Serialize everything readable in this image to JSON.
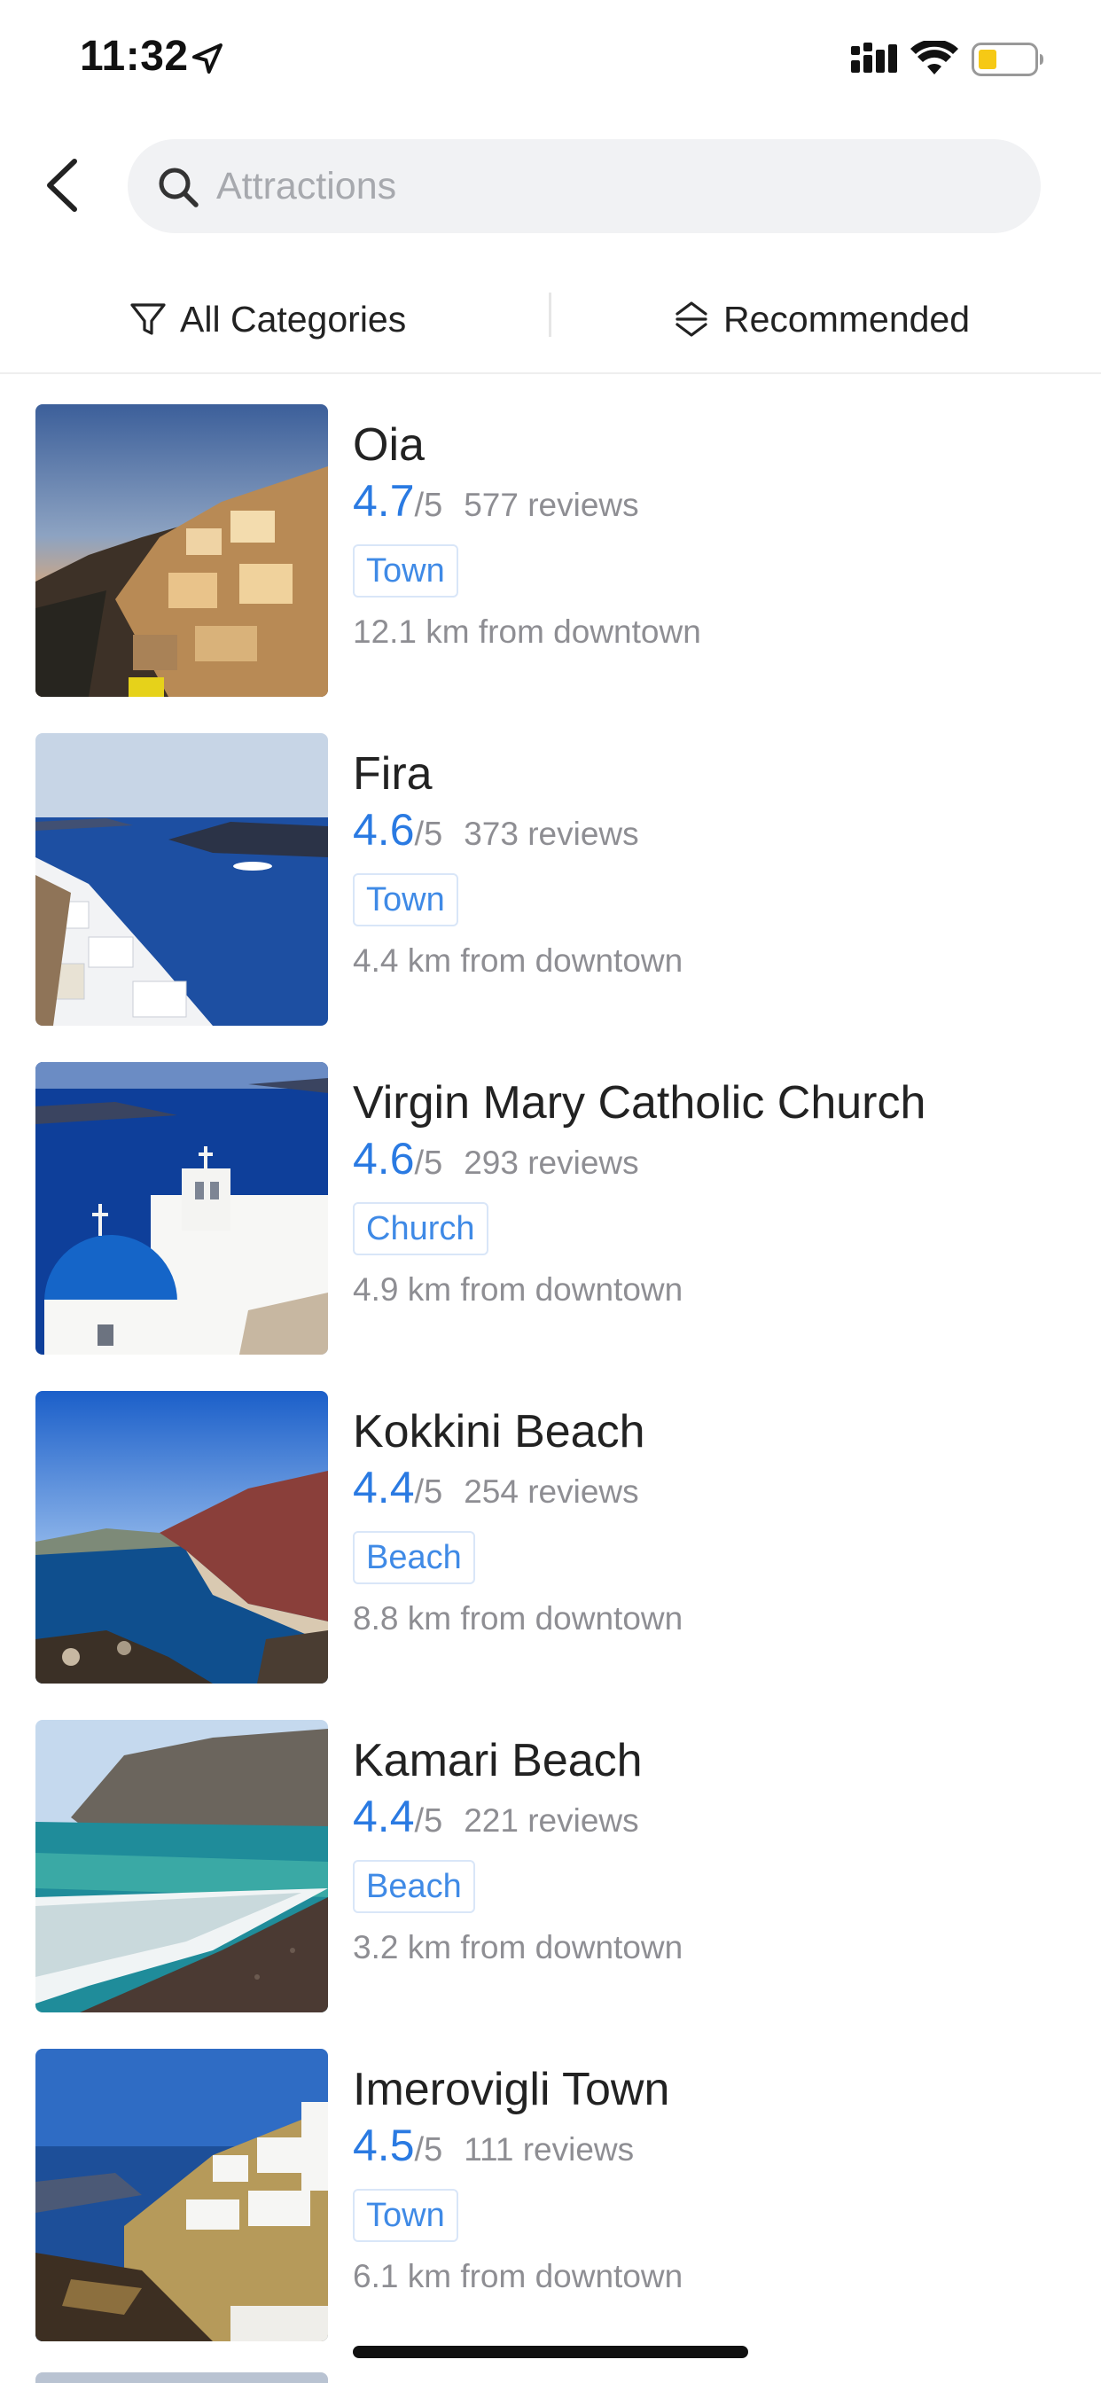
{
  "status_bar": {
    "time": "11:32",
    "icons": [
      "location-arrow-icon",
      "signal-icon",
      "wifi-icon",
      "battery-icon"
    ],
    "battery_color": "#f6c915"
  },
  "header": {
    "back_icon": "chevron-left-icon",
    "search": {
      "placeholder": "Attractions",
      "value": ""
    }
  },
  "filters": {
    "categories_label": "All Categories",
    "categories_icon": "filter-funnel-icon",
    "sort_label": "Recommended",
    "sort_icon": "sort-icon"
  },
  "colors": {
    "accent": "#2a7ae2",
    "tag_text": "#3f8ae6",
    "tag_border": "#d9e6f8",
    "secondary_text": "#8e8e93",
    "search_bg": "#f1f2f4"
  },
  "attractions": [
    {
      "name": "Oia",
      "score": "4.7",
      "out_of": "/5",
      "reviews": "577 reviews",
      "category": "Town",
      "distance": "12.1 km from downtown"
    },
    {
      "name": "Fira",
      "score": "4.6",
      "out_of": "/5",
      "reviews": "373 reviews",
      "category": "Town",
      "distance": "4.4 km from downtown"
    },
    {
      "name": "Virgin Mary Catholic Church",
      "score": "4.6",
      "out_of": "/5",
      "reviews": "293 reviews",
      "category": "Church",
      "distance": "4.9 km from downtown"
    },
    {
      "name": "Kokkini Beach",
      "score": "4.4",
      "out_of": "/5",
      "reviews": "254 reviews",
      "category": "Beach",
      "distance": "8.8 km from downtown"
    },
    {
      "name": "Kamari Beach",
      "score": "4.4",
      "out_of": "/5",
      "reviews": "221 reviews",
      "category": "Beach",
      "distance": "3.2 km from downtown"
    },
    {
      "name": "Imerovigli Town",
      "score": "4.5",
      "out_of": "/5",
      "reviews": "111 reviews",
      "category": "Town",
      "distance": "6.1 km from downtown"
    }
  ]
}
